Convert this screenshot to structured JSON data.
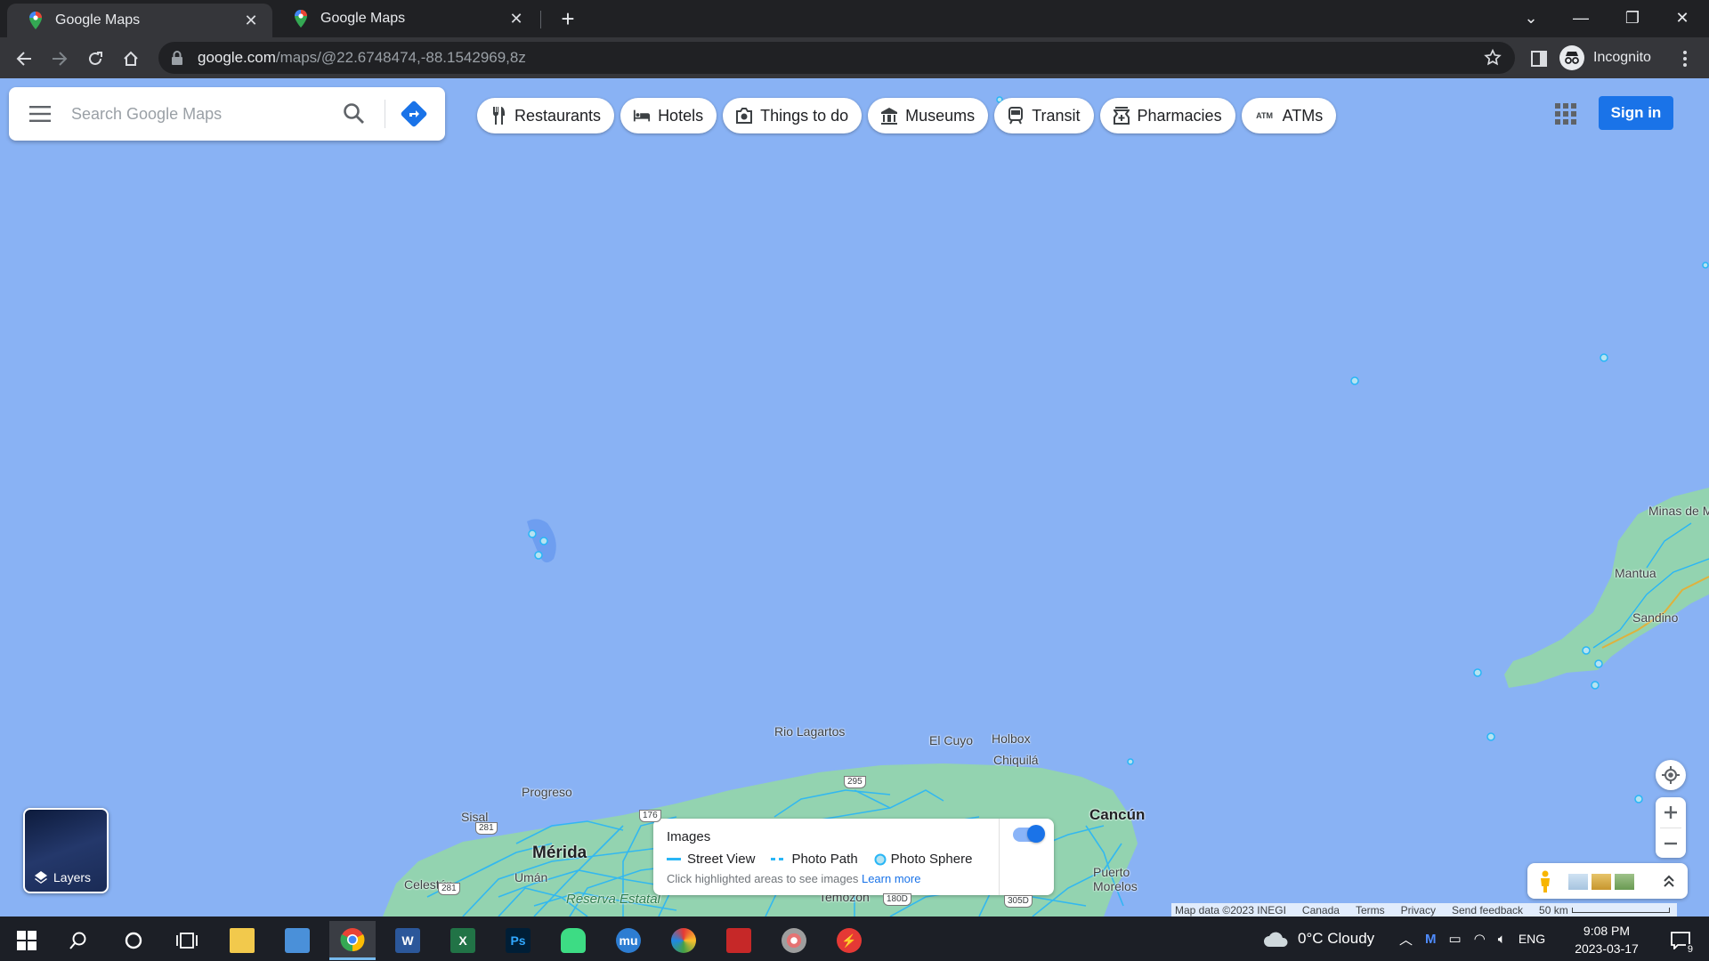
{
  "browser": {
    "tabs": [
      {
        "title": "Google Maps",
        "active": true
      },
      {
        "title": "Google Maps",
        "active": false
      }
    ],
    "url_host": "google.com",
    "url_path": "/maps/@22.6748474,-88.1542969,8z",
    "profile_label": "Incognito"
  },
  "maps": {
    "search_placeholder": "Search Google Maps",
    "chips": [
      {
        "label": "Restaurants",
        "icon": "restaurant-icon"
      },
      {
        "label": "Hotels",
        "icon": "hotel-bed-icon"
      },
      {
        "label": "Things to do",
        "icon": "camera-icon"
      },
      {
        "label": "Museums",
        "icon": "museum-icon"
      },
      {
        "label": "Transit",
        "icon": "train-icon"
      },
      {
        "label": "Pharmacies",
        "icon": "pharmacy-icon"
      },
      {
        "label": "ATMs",
        "icon": "atm-icon"
      }
    ],
    "sign_in_label": "Sign in",
    "layers_label": "Layers",
    "images_card": {
      "title": "Images",
      "legend": [
        "Street View",
        "Photo Path",
        "Photo Sphere"
      ],
      "hint": "Click highlighted areas to see images",
      "learn_more": "Learn more"
    },
    "places": [
      "Minas de Matahambre",
      "Mantua",
      "Sandino",
      "Rio Lagartos",
      "El Cuyo",
      "Holbox",
      "Chiquilá",
      "Progreso",
      "Sisal",
      "Mérida",
      "Umán",
      "Celestún",
      "Cancún",
      "Puerto Morelos",
      "Reserva Estatal",
      "Temozón"
    ],
    "road_shields": [
      "295",
      "281",
      "176",
      "281",
      "180D",
      "305D"
    ],
    "attribution": {
      "map_data": "Map data ©2023 INEGI",
      "links": [
        "Canada",
        "Terms",
        "Privacy",
        "Send feedback"
      ],
      "scale": "50 km"
    }
  },
  "taskbar": {
    "weather": "0°C  Cloudy",
    "language": "ENG",
    "time": "9:08 PM",
    "date": "2023-03-17",
    "notifications": "9"
  }
}
